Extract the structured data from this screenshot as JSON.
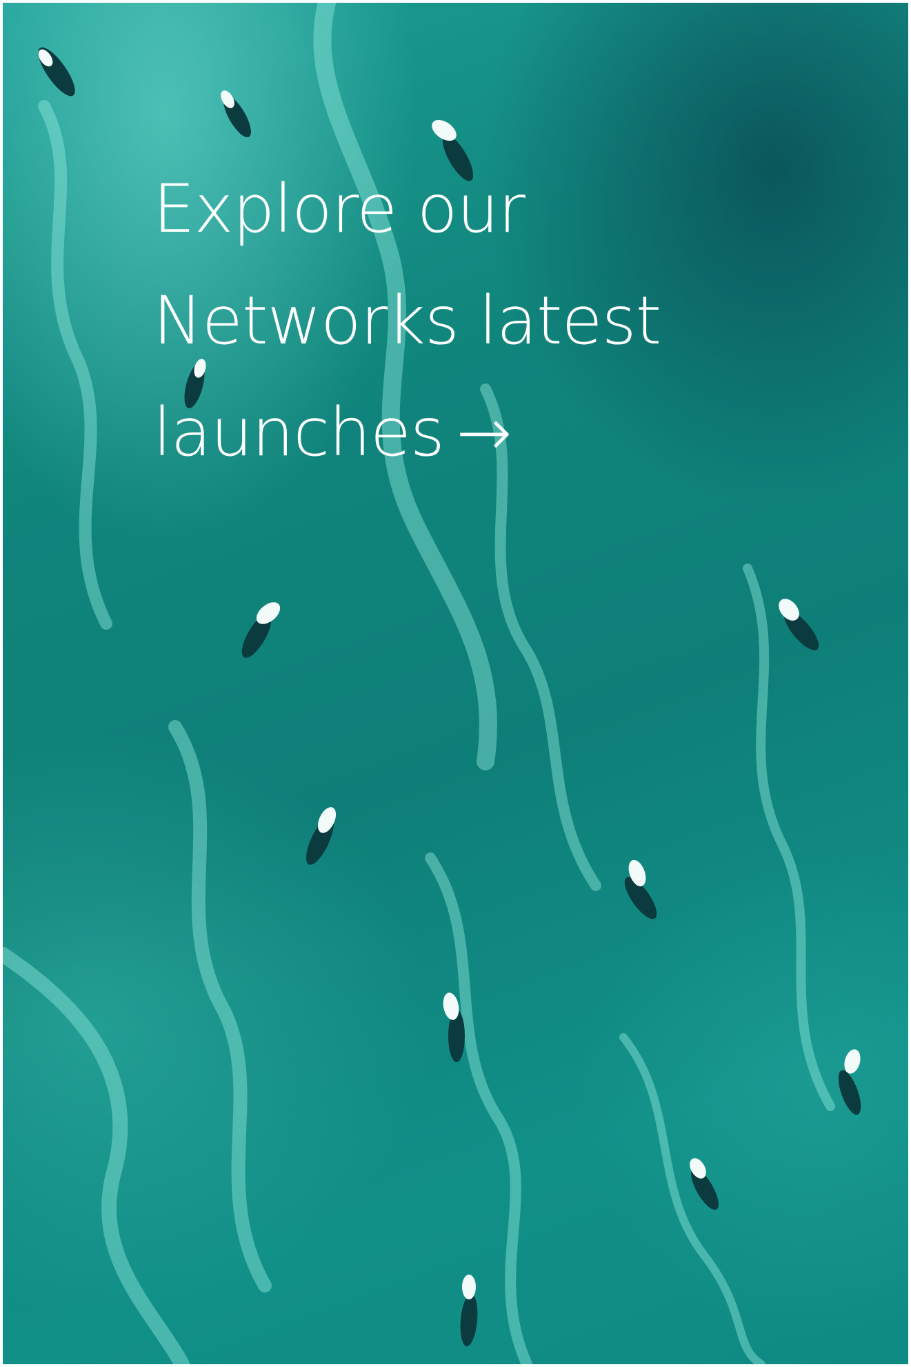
{
  "hero": {
    "cta": {
      "line1": "Explore our",
      "line2": "Networks latest",
      "line3": "launches",
      "arrow_icon": "arrow-right-icon",
      "arrow_glyph": "→"
    }
  },
  "colors": {
    "sea_dark": "#0e7f78",
    "sea_light": "#1c9e94",
    "foam": "#7fe3d8",
    "text": "#ffffff"
  }
}
